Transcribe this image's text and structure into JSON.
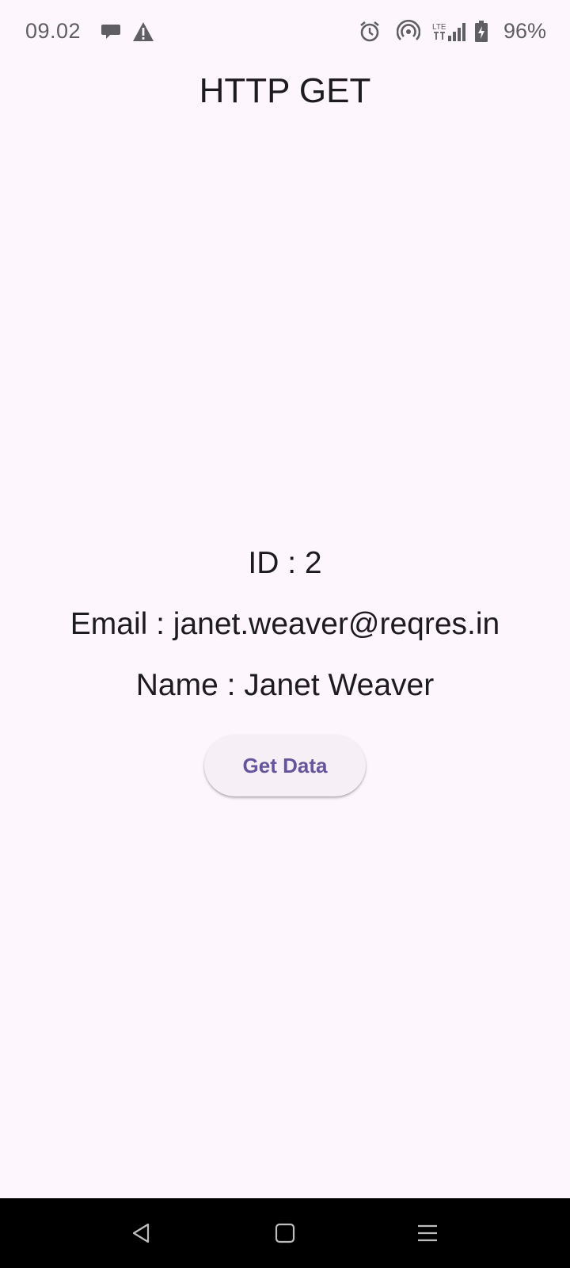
{
  "status_bar": {
    "time": "09.02",
    "battery_percent": "96%",
    "icons": [
      "chat-bubble-icon",
      "warning-icon",
      "alarm-icon",
      "hotspot-icon",
      "lte-signal-icon",
      "battery-charging-icon"
    ]
  },
  "app": {
    "title": "HTTP GET"
  },
  "user": {
    "id_line": "ID : 2",
    "email_line": "Email : janet.weaver@reqres.in",
    "name_line": "Name : Janet Weaver"
  },
  "actions": {
    "get_data_label": "Get Data"
  },
  "nav": {
    "icons": [
      "back-icon",
      "home-icon",
      "recents-icon"
    ]
  },
  "colors": {
    "background": "#fdf7fd",
    "button_text": "#65559a",
    "button_bg": "#f6f0f6"
  }
}
